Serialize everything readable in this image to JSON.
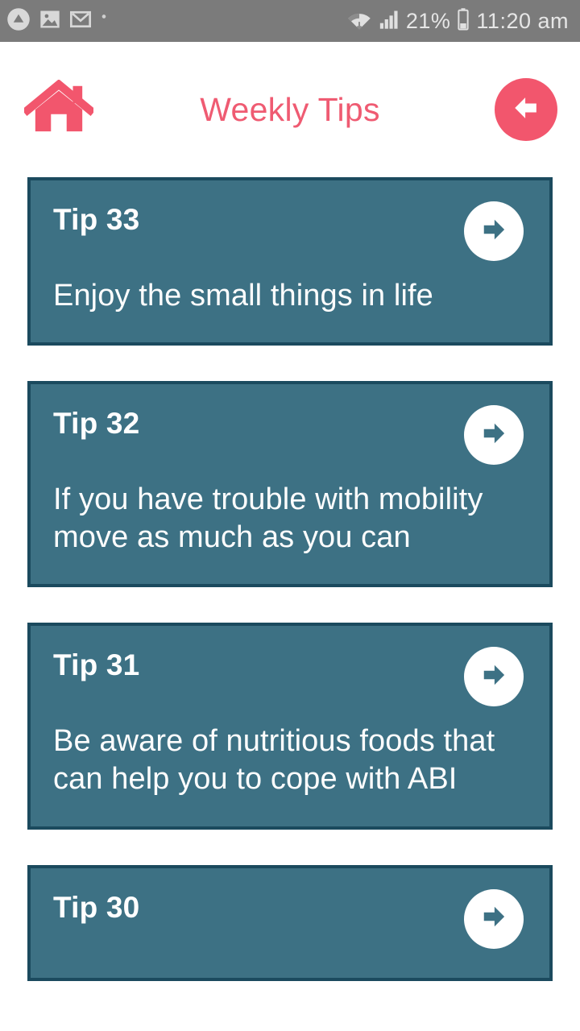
{
  "statusbar": {
    "left_icons": [
      "circled-caret-icon",
      "gallery-icon",
      "gmail-icon",
      "overflow-dot-icon"
    ],
    "wifi_icon": "wifi-transfer-icon",
    "signal_icon": "cellular-signal-icon",
    "battery_percent": "21%",
    "battery_icon": "battery-icon",
    "time": "11:20 am",
    "background": "#7b7b7b",
    "foreground": "#e6e6e6"
  },
  "header": {
    "home_icon": "home-icon",
    "title": "Weekly Tips",
    "back_icon": "arrow-left-icon",
    "accent": "#f2566d"
  },
  "theme": {
    "card_fill": "#3d7184",
    "card_border": "#1b4a5e",
    "card_text": "#ffffff",
    "page_background": "#ffffff"
  },
  "tips": [
    {
      "title": "Tip 33",
      "body": "Enjoy the small things in life",
      "go_icon": "arrow-right-icon"
    },
    {
      "title": "Tip 32",
      "body": "If you have trouble with mobility move as much as you can",
      "go_icon": "arrow-right-icon"
    },
    {
      "title": "Tip 31",
      "body": "Be aware of nutritious foods that can help you to cope with ABI",
      "go_icon": "arrow-right-icon"
    },
    {
      "title": "Tip 30",
      "body": "",
      "go_icon": "arrow-right-icon"
    }
  ]
}
